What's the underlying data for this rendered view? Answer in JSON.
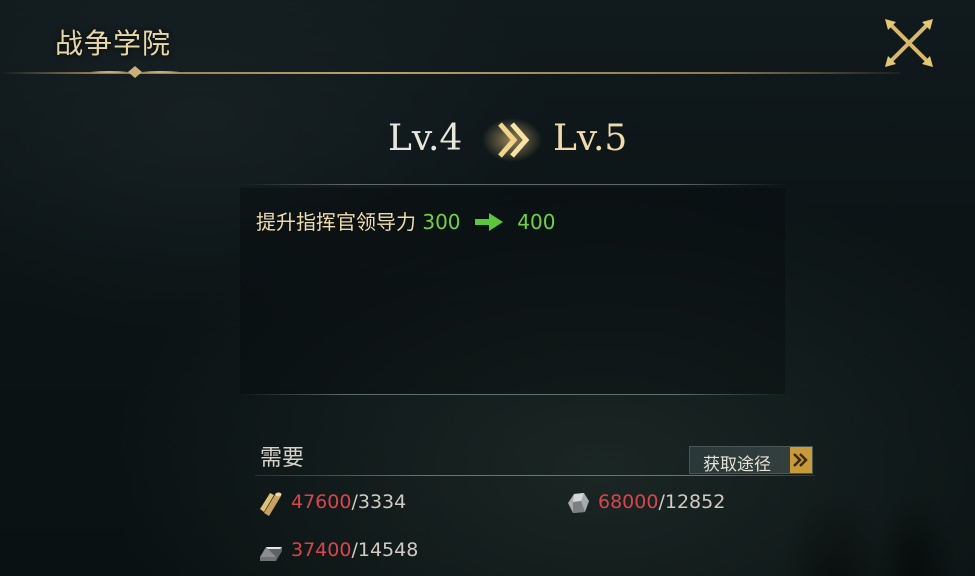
{
  "window": {
    "title": "战争学院",
    "close_icon": "crossed-swords-close-icon"
  },
  "level": {
    "from": "Lv.4",
    "to": "Lv.5",
    "arrow_icon": "double-chevron-right-icon"
  },
  "effect": {
    "label": "提升指挥官领导力",
    "from_value": "300",
    "to_value": "400",
    "arrow_icon": "green-arrow-right-icon"
  },
  "requirements": {
    "label": "需要",
    "obtain_button": "获取途径",
    "items": [
      {
        "icon": "wood-resource-icon",
        "have": "47600",
        "sep": "/",
        "need": "3334"
      },
      {
        "icon": "stone-resource-icon",
        "have": "68000",
        "sep": "/",
        "need": "12852"
      },
      {
        "icon": "iron-resource-icon",
        "have": "37400",
        "sep": "/",
        "need": "14548"
      }
    ]
  },
  "colors": {
    "gold": "#efdcaa",
    "green": "#6fd14a",
    "red": "#d9454d",
    "button_accent": "#c89a3a"
  }
}
